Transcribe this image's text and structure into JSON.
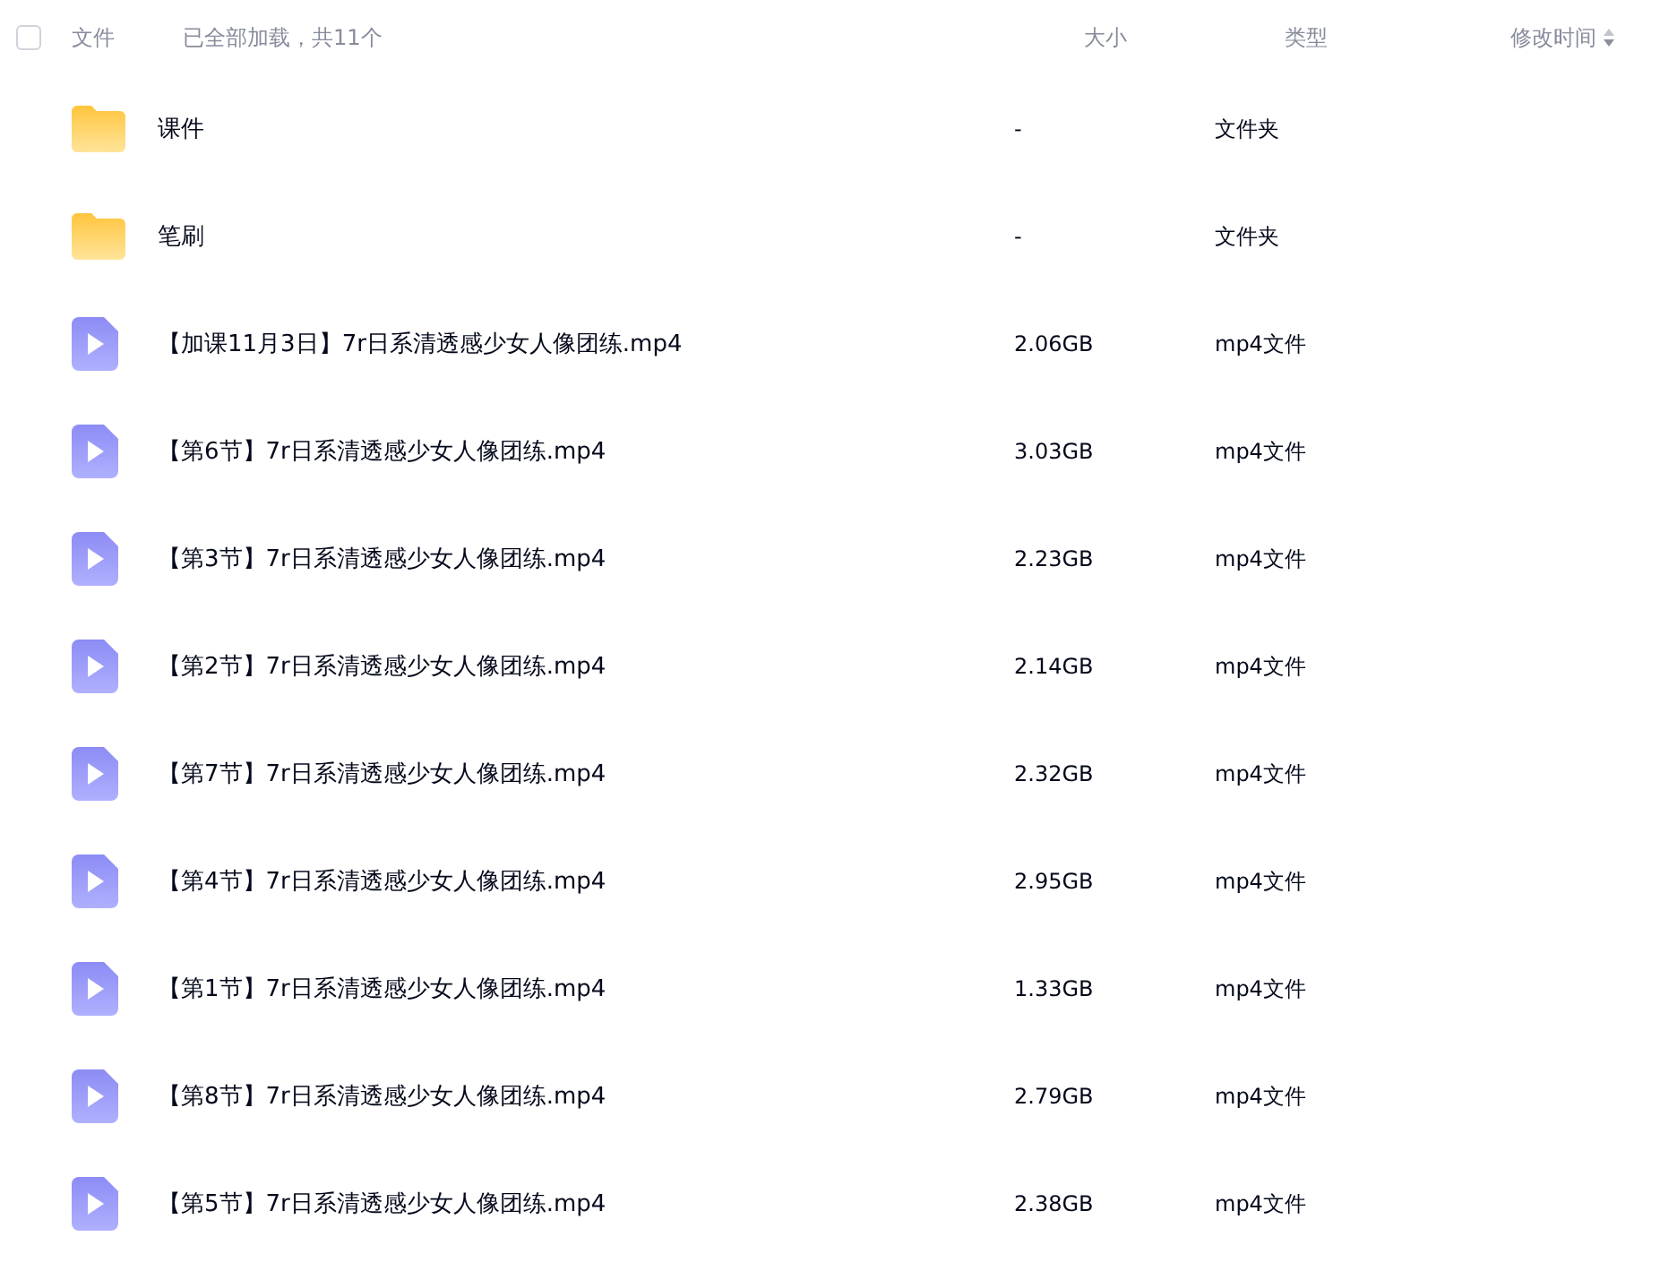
{
  "header": {
    "select_all": {
      "checked": false
    },
    "name_label": "文件",
    "count_text": "已全部加载，共11个",
    "size_label": "大小",
    "type_label": "类型",
    "modified_label": "修改时间"
  },
  "files": [
    {
      "kind": "folder",
      "name": "课件",
      "size": "-",
      "type": "文件夹"
    },
    {
      "kind": "folder",
      "name": "笔刷",
      "size": "-",
      "type": "文件夹"
    },
    {
      "kind": "video",
      "name": "【加课11月3日】7r日系清透感少女人像团练.mp4",
      "size": "2.06GB",
      "type": "mp4文件"
    },
    {
      "kind": "video",
      "name": "【第6节】7r日系清透感少女人像团练.mp4",
      "size": "3.03GB",
      "type": "mp4文件"
    },
    {
      "kind": "video",
      "name": "【第3节】7r日系清透感少女人像团练.mp4",
      "size": "2.23GB",
      "type": "mp4文件"
    },
    {
      "kind": "video",
      "name": "【第2节】7r日系清透感少女人像团练.mp4",
      "size": "2.14GB",
      "type": "mp4文件"
    },
    {
      "kind": "video",
      "name": "【第7节】7r日系清透感少女人像团练.mp4",
      "size": "2.32GB",
      "type": "mp4文件"
    },
    {
      "kind": "video",
      "name": "【第4节】7r日系清透感少女人像团练.mp4",
      "size": "2.95GB",
      "type": "mp4文件"
    },
    {
      "kind": "video",
      "name": "【第1节】7r日系清透感少女人像团练.mp4",
      "size": "1.33GB",
      "type": "mp4文件"
    },
    {
      "kind": "video",
      "name": "【第8节】7r日系清透感少女人像团练.mp4",
      "size": "2.79GB",
      "type": "mp4文件"
    },
    {
      "kind": "video",
      "name": "【第5节】7r日系清透感少女人像团练.mp4",
      "size": "2.38GB",
      "type": "mp4文件"
    }
  ]
}
